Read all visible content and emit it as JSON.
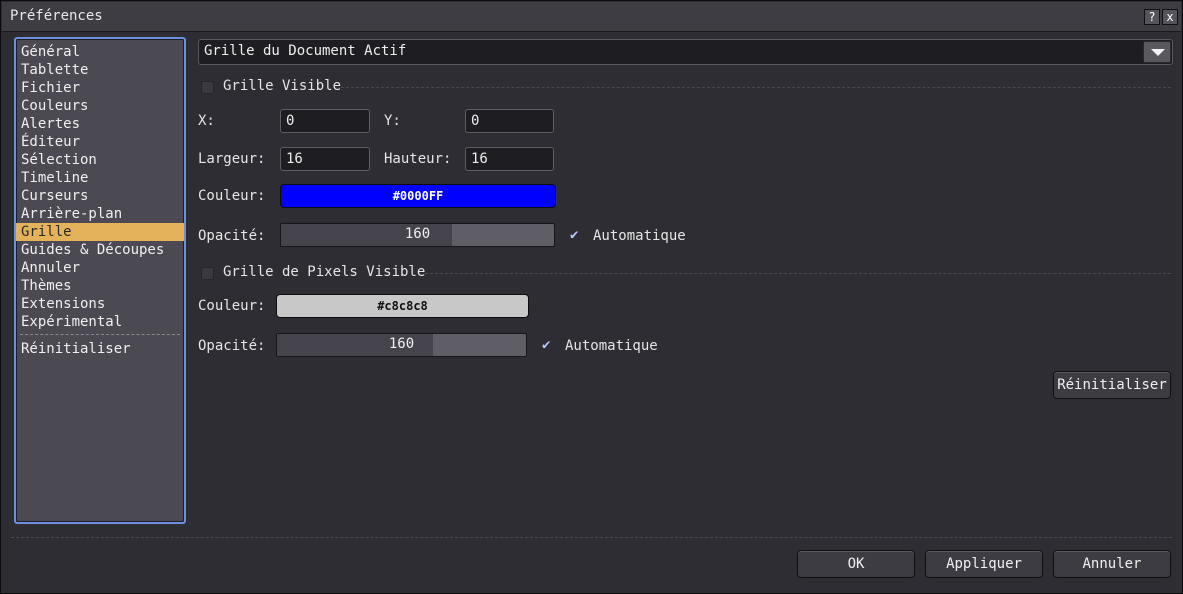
{
  "window": {
    "title": "Préférences",
    "help_label": "?",
    "close_label": "x"
  },
  "sidebar": {
    "items": [
      {
        "label": "Général"
      },
      {
        "label": "Tablette"
      },
      {
        "label": "Fichier"
      },
      {
        "label": "Couleurs"
      },
      {
        "label": "Alertes"
      },
      {
        "label": "Éditeur"
      },
      {
        "label": "Sélection"
      },
      {
        "label": "Timeline"
      },
      {
        "label": "Curseurs"
      },
      {
        "label": "Arrière-plan"
      },
      {
        "label": "Grille"
      },
      {
        "label": "Guides & Découpes"
      },
      {
        "label": "Annuler"
      },
      {
        "label": "Thèmes"
      },
      {
        "label": "Extensions"
      },
      {
        "label": "Expérimental"
      }
    ],
    "active_index": 10,
    "reset_label": "Réinitialiser"
  },
  "grid": {
    "scope": "Grille du Document Actif",
    "visible_label": "Grille Visible",
    "visible_checked": false,
    "x_label": "X:",
    "x_value": "0",
    "y_label": "Y:",
    "y_value": "0",
    "width_label": "Largeur:",
    "width_value": "16",
    "height_label": "Hauteur:",
    "height_value": "16",
    "color_label": "Couleur:",
    "color_value": "#0000FF",
    "color_hex": "#0000ff",
    "opacity_label": "Opacité:",
    "opacity_value": "160",
    "opacity_fraction": 0.627,
    "auto_label": "Automatique",
    "auto_checked": true
  },
  "pixel_grid": {
    "visible_label": "Grille de Pixels Visible",
    "visible_checked": false,
    "color_label": "Couleur:",
    "color_value": "#c8c8c8",
    "color_hex": "#c8c8c8",
    "opacity_label": "Opacité:",
    "opacity_value": "160",
    "opacity_fraction": 0.627,
    "auto_label": "Automatique",
    "auto_checked": true
  },
  "reset_button": "Réinitialiser",
  "footer": {
    "ok": "OK",
    "apply": "Appliquer",
    "cancel": "Annuler"
  }
}
